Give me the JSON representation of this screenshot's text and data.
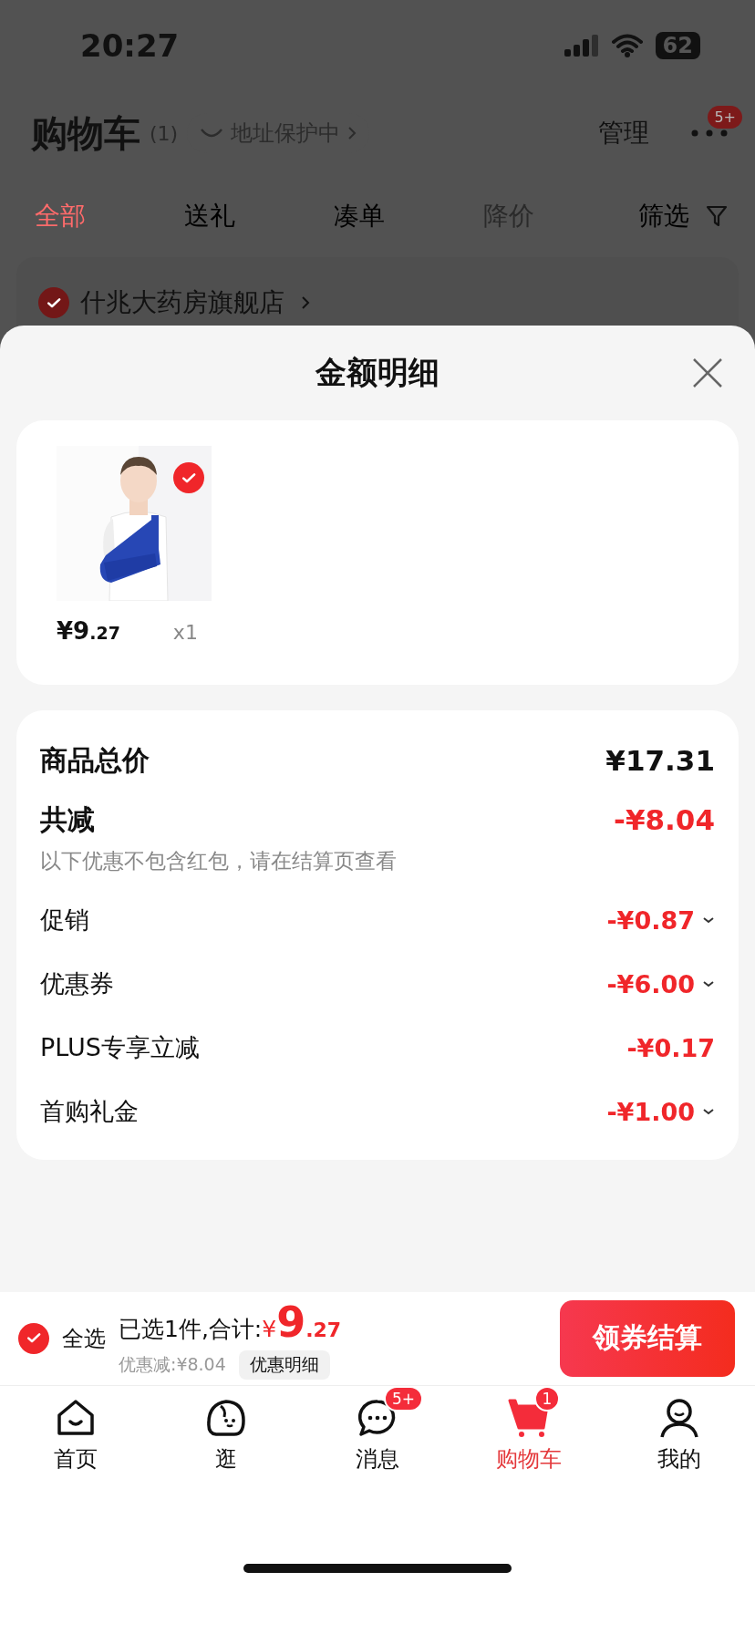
{
  "status_bar": {
    "time": "20:27",
    "battery": "62"
  },
  "header": {
    "title": "购物车",
    "count": "(1)",
    "address_badge": "地址保护中",
    "manage": "管理",
    "more_badge": "5+"
  },
  "filter_tabs": [
    {
      "label": "全部",
      "selected": true,
      "disabled": false
    },
    {
      "label": "送礼",
      "selected": false,
      "disabled": false
    },
    {
      "label": "凑单",
      "selected": false,
      "disabled": false
    },
    {
      "label": "降价",
      "selected": false,
      "disabled": true
    }
  ],
  "filter": {
    "label": "筛选"
  },
  "store": {
    "name": "什兆大药房旗舰店",
    "checked": true
  },
  "sheet": {
    "title": "金额明细"
  },
  "products": [
    {
      "kind": "picture",
      "selected": true,
      "price_main": "¥9",
      "price_decimal": ".27",
      "quantity": "x1"
    }
  ],
  "summary": {
    "total_label": "商品总价",
    "total": "¥17.31",
    "discount_label": "共减",
    "discount": "-¥8.04",
    "note": "以下优惠不包含红包，请在结算页查看"
  },
  "discounts": [
    {
      "label": "促销",
      "amount": "-¥0.87",
      "expandable": true
    },
    {
      "label": "优惠券",
      "amount": "-¥6.00",
      "expandable": true
    },
    {
      "label": "PLUS专享立减",
      "amount": "-¥0.17",
      "expandable": false
    },
    {
      "label": "首购礼金",
      "amount": "-¥1.00",
      "expandable": true
    }
  ],
  "checkout_bar": {
    "select_all": "全选",
    "select_all_checked": true,
    "selected_text": "已选1件,合计:",
    "currency": "¥",
    "total_main": "9",
    "total_decimal": ".27",
    "savings": "优惠减:¥8.04",
    "details_button": "优惠明细",
    "checkout_button": "领券结算"
  },
  "nav": [
    {
      "label": "首页",
      "selected": false
    },
    {
      "label": "逛",
      "selected": false
    },
    {
      "label": "消息",
      "selected": false,
      "badge": "5+"
    },
    {
      "label": "购物车",
      "selected": true,
      "badge": "1"
    },
    {
      "label": "我的",
      "selected": false
    }
  ]
}
